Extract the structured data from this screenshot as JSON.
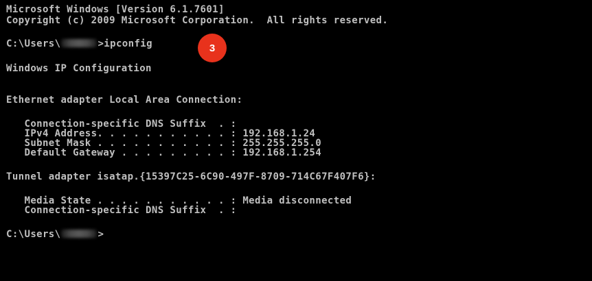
{
  "console": {
    "header_line1": "Microsoft Windows [Version 6.1.7601]",
    "header_line2": "Copyright (c) 2009 Microsoft Corporation.  All rights reserved.",
    "prompt1_prefix": "C:\\Users\\",
    "prompt1_suffix": ">ipconfig",
    "ip_config_title": "Windows IP Configuration",
    "ethernet_header": "Ethernet adapter Local Area Connection:",
    "eth_dns_suffix": "   Connection-specific DNS Suffix  . :",
    "eth_ipv4": "   IPv4 Address. . . . . . . . . . . : 192.168.1.24",
    "eth_subnet": "   Subnet Mask . . . . . . . . . . . : 255.255.255.0",
    "eth_gateway": "   Default Gateway . . . . . . . . . : 192.168.1.254",
    "tunnel_header": "Tunnel adapter isatap.{15397C25-6C90-497F-8709-714C67F407F6}:",
    "tunnel_media_state": "   Media State . . . . . . . . . . . : Media disconnected",
    "tunnel_dns_suffix": "   Connection-specific DNS Suffix  . :",
    "prompt2_prefix": "C:\\Users\\",
    "prompt2_suffix": ">"
  },
  "annotation": {
    "step_number": "3",
    "badge_color": "#e8321c"
  },
  "colors": {
    "background": "#000000",
    "text": "#c0c0c0"
  }
}
